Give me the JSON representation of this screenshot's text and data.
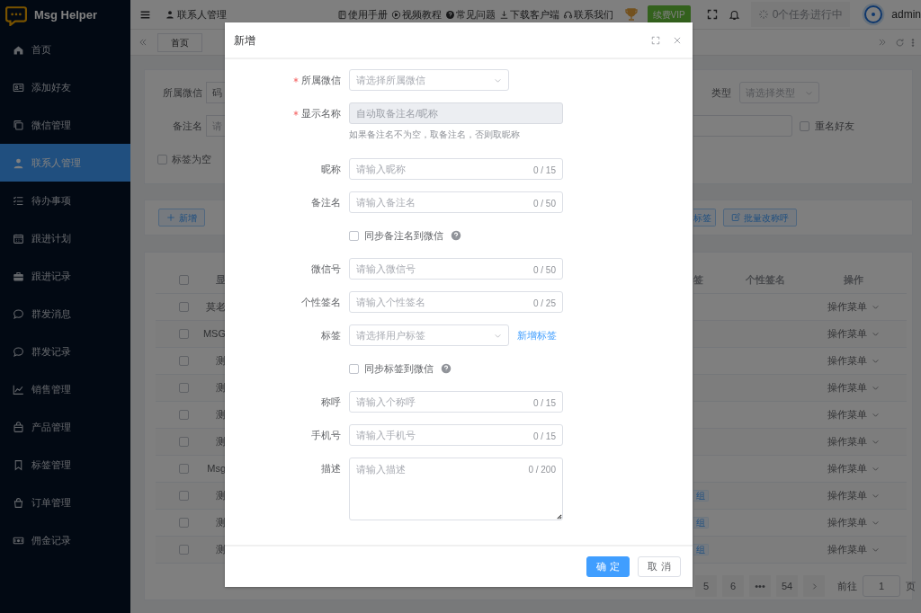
{
  "app": {
    "name": "Msg Helper"
  },
  "sidebar": {
    "items": [
      {
        "label": "首页",
        "selected": false
      },
      {
        "label": "添加好友",
        "selected": false
      },
      {
        "label": "微信管理",
        "selected": false
      },
      {
        "label": "联系人管理",
        "selected": true
      },
      {
        "label": "待办事项",
        "selected": false
      },
      {
        "label": "跟进计划",
        "selected": false
      },
      {
        "label": "跟进记录",
        "selected": false
      },
      {
        "label": "群发消息",
        "selected": false
      },
      {
        "label": "群发记录",
        "selected": false
      },
      {
        "label": "销售管理",
        "selected": false
      },
      {
        "label": "产品管理",
        "selected": false
      },
      {
        "label": "标签管理",
        "selected": false
      },
      {
        "label": "订单管理",
        "selected": false
      },
      {
        "label": "佣金记录",
        "selected": false
      }
    ]
  },
  "header": {
    "breadcrumb": "联系人管理",
    "links": [
      "使用手册",
      "视频教程",
      "常见问题",
      "下载客户端",
      "联系我们"
    ],
    "vip_button": "续费VIP",
    "tasks": "0个任务进行中",
    "user": "admin"
  },
  "tabs": [
    {
      "label": "首页",
      "selected": false
    }
  ],
  "filters": {
    "wechat_label": "所属微信",
    "wechat_value": "码",
    "remark_label": "备注名",
    "remark_placeholder": "请",
    "empty_tag": {
      "label": "标签为空",
      "checked": false
    },
    "type_label": "类型",
    "type_placeholder": "请选择类型",
    "duplicate": {
      "label": "重名好友",
      "checked": false
    }
  },
  "toolbar": {
    "add_button": "新增",
    "tag_button": "标签",
    "rename_button": "批量改称呼"
  },
  "table": {
    "select_all": {
      "checked": false
    },
    "columns": [
      "显",
      "签",
      "个性签名",
      "操作"
    ],
    "rows": [
      {
        "name": "莫老",
        "action": "操作菜单",
        "selected": false
      },
      {
        "name": "MSG",
        "action": "操作菜单",
        "selected": false
      },
      {
        "name": "测",
        "action": "操作菜单",
        "selected": false
      },
      {
        "name": "测",
        "action": "操作菜单",
        "selected": false
      },
      {
        "name": "测",
        "action": "操作菜单",
        "selected": false
      },
      {
        "name": "测",
        "action": "操作菜单",
        "selected": false
      },
      {
        "name": "Msg",
        "action": "操作菜单",
        "selected": false
      },
      {
        "name": "测",
        "tag": "组",
        "action": "操作菜单",
        "selected": false
      },
      {
        "name": "测",
        "tag": "组",
        "action": "操作菜单",
        "selected": false
      },
      {
        "name": "测",
        "tag": "组",
        "action": "操作菜单",
        "selected": false
      }
    ]
  },
  "pagination": {
    "pages": [
      {
        "label": "5",
        "selected": false
      },
      {
        "label": "6",
        "selected": false
      },
      {
        "label": "•••",
        "selected": false
      },
      {
        "label": "54",
        "selected": false
      }
    ],
    "goto_label": "前往",
    "goto_value": "1",
    "page_suffix": "页"
  },
  "modal": {
    "title": "新增",
    "fields": [
      {
        "kind": "select",
        "label": "所属微信",
        "required": true,
        "placeholder": "请选择所属微信"
      },
      {
        "kind": "input",
        "label": "显示名称",
        "required": true,
        "disabled": true,
        "placeholder": "自动取备注名/昵称",
        "hint": "如果备注名不为空，取备注名，否则取昵称"
      },
      {
        "kind": "input",
        "label": "昵称",
        "required": false,
        "disabled": false,
        "placeholder": "请输入昵称",
        "counter": "0 / 15"
      },
      {
        "kind": "input",
        "label": "备注名",
        "required": false,
        "disabled": false,
        "placeholder": "请输入备注名",
        "counter": "0 / 50"
      },
      {
        "kind": "checkbox",
        "label": "同步备注名到微信",
        "checked": false
      },
      {
        "kind": "input",
        "label": "微信号",
        "required": false,
        "disabled": false,
        "placeholder": "请输入微信号",
        "counter": "0 / 50"
      },
      {
        "kind": "input",
        "label": "个性签名",
        "required": false,
        "disabled": false,
        "placeholder": "请输入个性签名",
        "counter": "0 / 25"
      },
      {
        "kind": "select",
        "label": "标签",
        "required": false,
        "placeholder": "请选择用户标签",
        "link": "新增标签"
      },
      {
        "kind": "checkbox",
        "label": "同步标签到微信",
        "checked": false
      },
      {
        "kind": "input",
        "label": "称呼",
        "required": false,
        "disabled": false,
        "placeholder": "请输入个称呼",
        "counter": "0 / 15"
      },
      {
        "kind": "input",
        "label": "手机号",
        "required": false,
        "disabled": false,
        "placeholder": "请输入手机号",
        "counter": "0 / 15"
      },
      {
        "kind": "textarea",
        "label": "描述",
        "required": false,
        "placeholder": "请输入描述",
        "counter": "0 / 200"
      }
    ],
    "buttons": [
      {
        "label": "确 定",
        "primary": true
      },
      {
        "label": "取 消",
        "primary": false
      }
    ]
  }
}
